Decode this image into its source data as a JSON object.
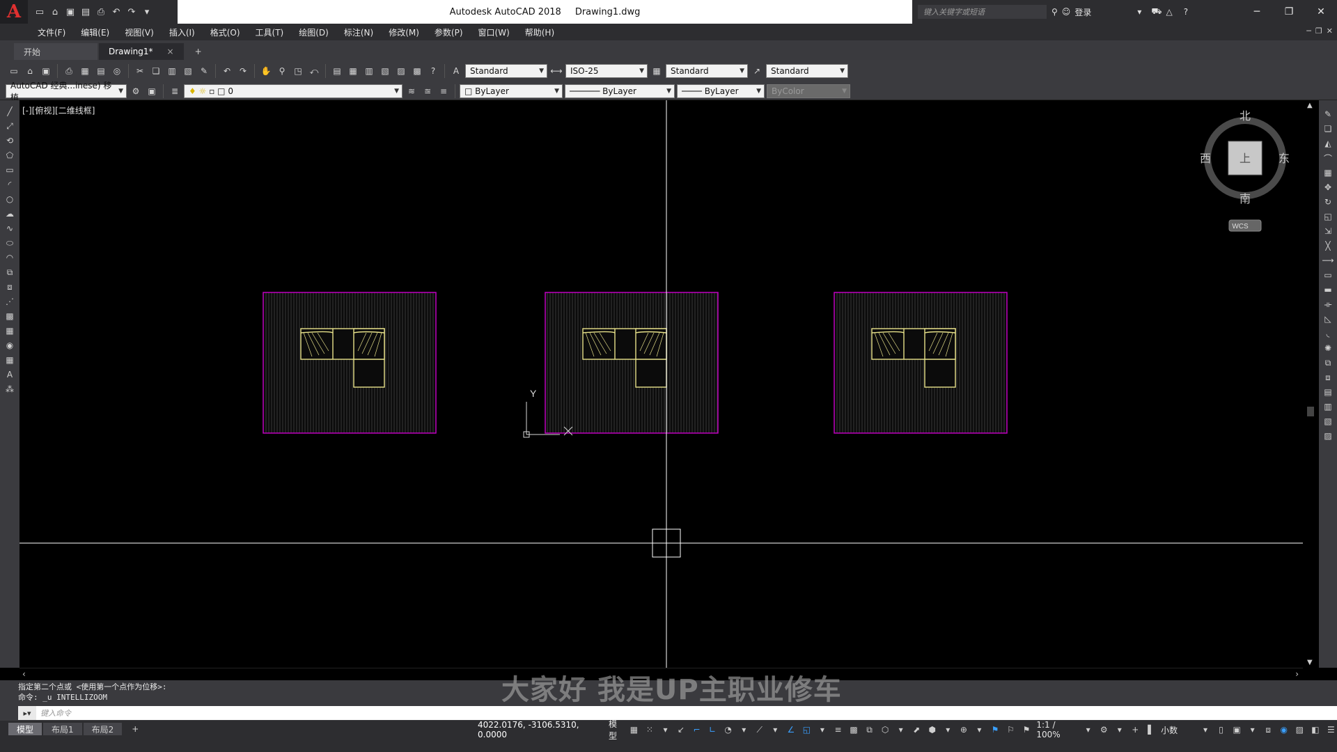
{
  "app": {
    "title": "Autodesk AutoCAD 2018",
    "file": "Drawing1.dwg",
    "logo": "A",
    "search_placeholder": "键入关键字或短语",
    "login": "登录"
  },
  "menu": [
    "文件(F)",
    "编辑(E)",
    "视图(V)",
    "插入(I)",
    "格式(O)",
    "工具(T)",
    "绘图(D)",
    "标注(N)",
    "修改(M)",
    "参数(P)",
    "窗口(W)",
    "帮助(H)"
  ],
  "tabs": {
    "start": "开始",
    "drawing": "Drawing1*",
    "close": "×",
    "add": "+"
  },
  "toolbar1": {
    "text_style": "Standard",
    "dim_style": "ISO-25",
    "table_style": "Standard",
    "mleader_style": "Standard"
  },
  "toolbar2": {
    "workspace": "AutoCAD 经典...inese) 移植",
    "layer": "0",
    "color": "ByLayer",
    "linetype": "ByLayer",
    "lineweight": "ByLayer",
    "plotstyle": "ByColor"
  },
  "viewport": {
    "label": "[-][俯视][二维线框]"
  },
  "viewcube": {
    "north": "北",
    "south": "南",
    "east": "东",
    "west": "西",
    "face": "上",
    "wcs": "WCS"
  },
  "ucs": {
    "y": "Y",
    "x": "X"
  },
  "command": {
    "history": [
      "指定第二个点或 <使用第一个点作为位移>:",
      "命令: _u INTELLIZOOM"
    ],
    "placeholder": "键入命令"
  },
  "watermark": "大家好 我是UP主职业修车",
  "layouts": [
    "模型",
    "布局1",
    "布局2"
  ],
  "status": {
    "coords": "4022.0176, -3106.5310, 0.0000",
    "model": "模型",
    "scale": "1:1 / 100%",
    "units": "小数"
  },
  "colors": {
    "frame": "#c000c0",
    "sofa": "#e8e28a",
    "hatch": "#3a3a3a",
    "crosshair": "#ffffff"
  }
}
